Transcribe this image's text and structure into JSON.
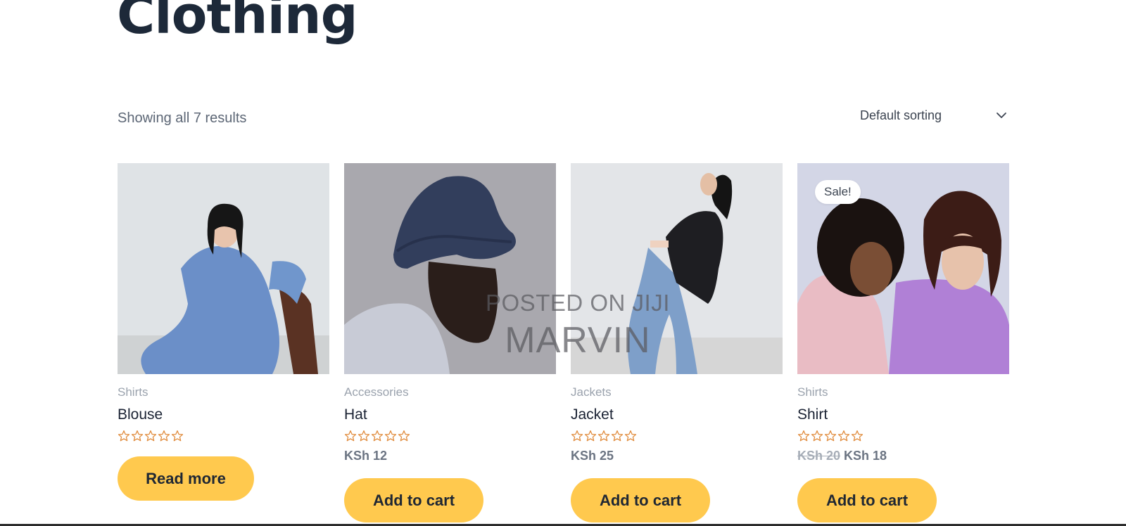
{
  "page": {
    "title": "Clothing"
  },
  "toolbar": {
    "result_count": "Showing all 7 results",
    "sorting": "Default sorting"
  },
  "products": [
    {
      "category": "Shirts",
      "name": "Blouse",
      "price": "",
      "button": "Read more",
      "rating": 0
    },
    {
      "category": "Accessories",
      "name": "Hat",
      "price": "KSh 12",
      "button": "Add to cart",
      "rating": 0
    },
    {
      "category": "Jackets",
      "name": "Jacket",
      "price": "KSh 25",
      "button": "Add to cart",
      "rating": 0
    },
    {
      "category": "Shirts",
      "name": "Shirt",
      "price_old": "KSh 20",
      "price": "KSh 18",
      "button": "Add to cart",
      "badge": "Sale!",
      "rating": 0
    }
  ],
  "watermark": {
    "line1": "POSTED ON JIJI",
    "line2": "MARVIN"
  },
  "colors": {
    "button": "#ffc94e",
    "star": "#e08a3a",
    "title": "#1d2939"
  }
}
